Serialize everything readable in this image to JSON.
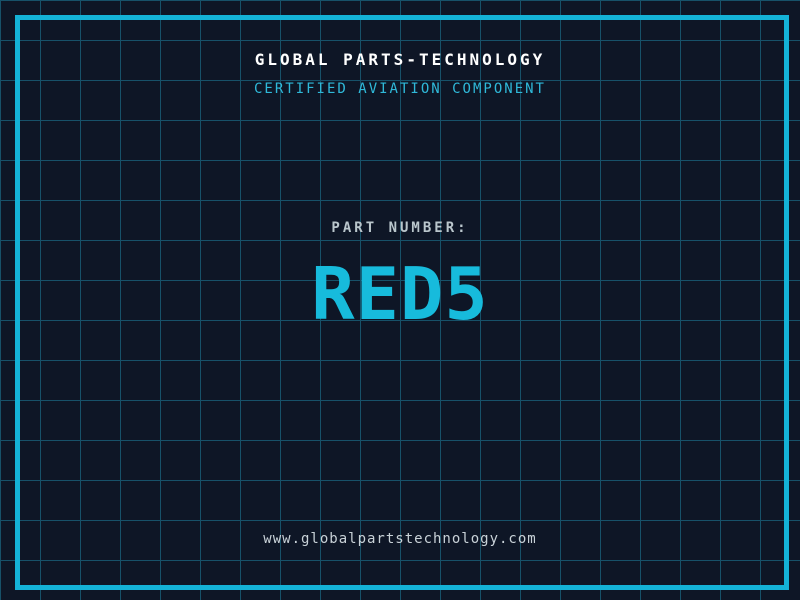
{
  "theme": {
    "background": "#0e1626",
    "grid_line": "#175169",
    "frame_border": "#14b2d7",
    "title_color": "#ffffff",
    "subtitle_color": "#2fb9d9",
    "part_label_color": "#bac6cc",
    "part_number_color": "#17bbdc",
    "url_color": "#c9d2d8"
  },
  "header": {
    "title": "GLOBAL PARTS-TECHNOLOGY",
    "subtitle": "CERTIFIED AVIATION COMPONENT"
  },
  "part": {
    "label": "PART NUMBER:",
    "number": "RED5"
  },
  "footer": {
    "url": "www.globalpartstechnology.com"
  }
}
